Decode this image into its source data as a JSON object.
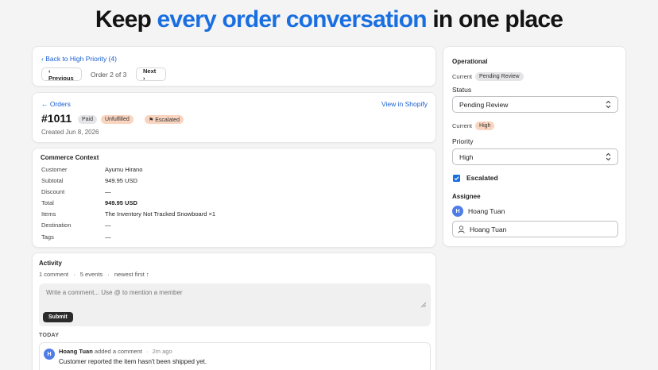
{
  "hero": {
    "prefix": "Keep ",
    "accent": "every order conversation",
    "suffix": " in one place"
  },
  "nav_card": {
    "back_link": "‹ Back to High Priority (4)",
    "previous_label": "‹ Previous",
    "position_text": "Order 2 of 3",
    "next_label": "Next ›"
  },
  "order": {
    "orders_link": "← Orders",
    "view_in_shopify": "View in Shopify",
    "number": "#1011",
    "badges": {
      "paid": "Paid",
      "unfulfilled": "Unfulfilled",
      "escalated": "⚑ Escalated"
    },
    "created": "Created Jun 8, 2026"
  },
  "commerce": {
    "title": "Commerce Context",
    "rows": [
      {
        "key": "Customer",
        "value": "Ayumu Hirano"
      },
      {
        "key": "Subtotal",
        "value": "949.95 USD"
      },
      {
        "key": "Discount",
        "value": "—"
      },
      {
        "key": "Total",
        "value": "949.95 USD"
      },
      {
        "key": "Items",
        "value": "The Inventory Not Tracked Snowboard ×1"
      },
      {
        "key": "Destination",
        "value": "—"
      },
      {
        "key": "Tags",
        "value": "—"
      }
    ]
  },
  "activity": {
    "title": "Activity",
    "comment_count": "1 comment",
    "event_count": "5 events",
    "sort": "newest first ↑",
    "comment_placeholder": "Write a comment... Use @ to mention a member",
    "submit_label": "Submit",
    "day_label": "TODAY",
    "comment": {
      "avatar_initial": "H",
      "author": "Hoang Tuan",
      "action": "added a comment",
      "time": "2m ago",
      "text": "Customer reported the item hasn't been shipped yet."
    }
  },
  "operational": {
    "title": "Operational",
    "current_label": "Current",
    "status_current": "Pending Review",
    "status_label": "Status",
    "status_value": "Pending Review",
    "priority_current": "High",
    "priority_label": "Priority",
    "priority_value": "High",
    "escalated_label": "Escalated",
    "assignee_label": "Assignee",
    "assignee_initial": "H",
    "assignee_name": "Hoang Tuan",
    "assignee_input_value": "Hoang Tuan"
  },
  "colors": {
    "accent": "#1a6fe0",
    "orange_badge": "#f9d4bf",
    "gray_badge": "#e5e5e7",
    "avatar": "#4f7de8"
  }
}
